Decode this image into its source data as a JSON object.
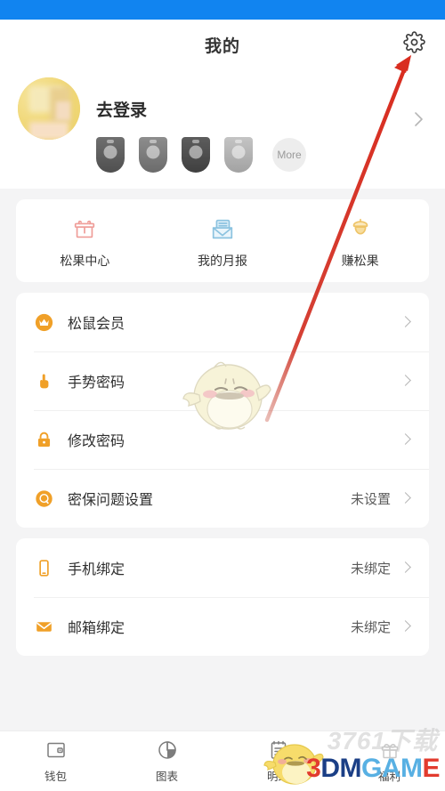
{
  "statusbar": {
    "color": "#1184f0"
  },
  "header": {
    "title": "我的",
    "gear_icon": "gear-icon"
  },
  "profile": {
    "login_text": "去登录",
    "avatar_alt": "user-avatar",
    "badges": [
      {
        "name": "badge-1",
        "shade": "#5f5f5f"
      },
      {
        "name": "badge-2",
        "shade": "#7d7d7d"
      },
      {
        "name": "badge-3",
        "shade": "#4d4d4d"
      },
      {
        "name": "badge-4",
        "shade": "#b3b3b3"
      }
    ],
    "more_label": "More"
  },
  "quick_actions": [
    {
      "label": "松果中心",
      "icon": "gift-icon",
      "color": "#ef9d98"
    },
    {
      "label": "我的月报",
      "icon": "envelope-icon",
      "color": "#8cc3e0"
    },
    {
      "label": "赚松果",
      "icon": "acorn-icon",
      "color": "#eec468"
    }
  ],
  "menu_group_1": [
    {
      "label": "松鼠会员",
      "value": "",
      "icon": "crown-icon"
    },
    {
      "label": "手势密码",
      "value": "",
      "icon": "hand-pointer-icon"
    },
    {
      "label": "修改密码",
      "value": "",
      "icon": "lock-icon"
    },
    {
      "label": "密保问题设置",
      "value": "未设置",
      "icon": "question-circle-icon"
    }
  ],
  "menu_group_2": [
    {
      "label": "手机绑定",
      "value": "未绑定",
      "icon": "phone-icon"
    },
    {
      "label": "邮箱绑定",
      "value": "未绑定",
      "icon": "mail-icon"
    }
  ],
  "bottom_nav": [
    {
      "label": "钱包",
      "icon": "wallet-icon"
    },
    {
      "label": "图表",
      "icon": "pie-chart-icon"
    },
    {
      "label": "明细",
      "icon": "list-note-icon"
    },
    {
      "label": "福利",
      "icon": "gift-benefit-icon"
    }
  ],
  "annotation": {
    "arrow_color": "#d92d20",
    "arrow_from": "307,468",
    "arrow_to": "461,66"
  },
  "watermarks": {
    "site": "3761下载",
    "brand_1": "3",
    "brand_2": "DM",
    "brand_3": "GAM",
    "brand_4": "E"
  }
}
